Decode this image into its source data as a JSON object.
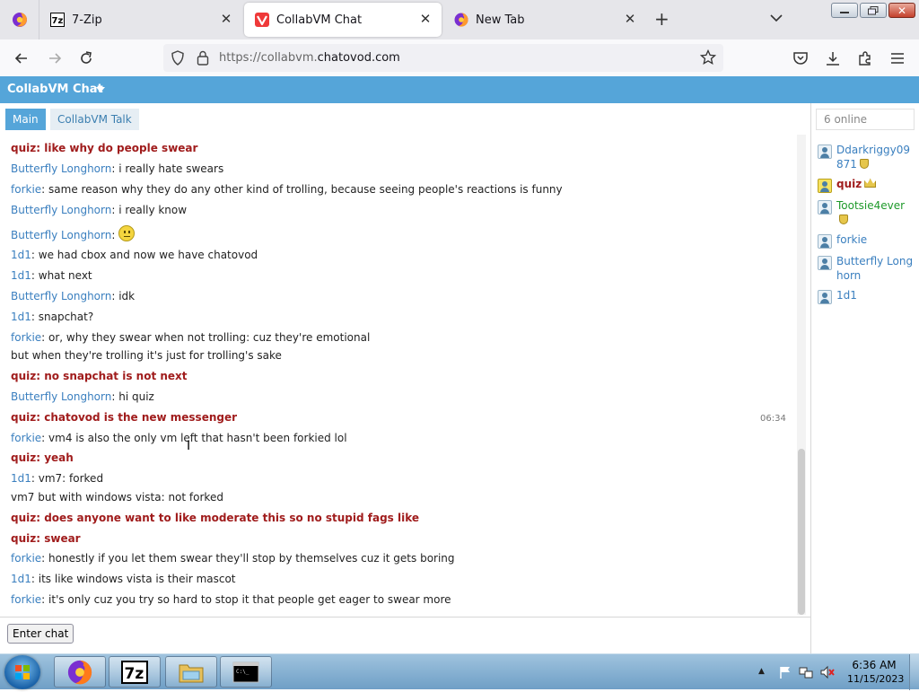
{
  "browser": {
    "tabs": [
      {
        "label": "7-Zip",
        "icon": "7zip-favicon"
      },
      {
        "label": "CollabVM Chat",
        "icon": "vivaldi-favicon",
        "active": true
      },
      {
        "label": "New Tab",
        "icon": "firefox-favicon"
      }
    ],
    "url": {
      "prefix": "https://collabvm.",
      "host": "chatovod.com"
    }
  },
  "app": {
    "title": "CollabVM Chat",
    "channel_tabs": [
      "Main",
      "CollabVM Talk"
    ],
    "enter_chat_label": "Enter chat",
    "timestamp": "06:34"
  },
  "messages": [
    {
      "user": "quiz",
      "text": "like why do people swear",
      "highlight": true
    },
    {
      "user": "Butterfly Longhorn",
      "text": "i really hate swears"
    },
    {
      "user": "forkie",
      "text": "same reason why they do any other kind of trolling, because seeing people's reactions is funny"
    },
    {
      "user": "Butterfly Longhorn",
      "text": "i really know"
    },
    {
      "user": "Butterfly Longhorn",
      "text": "",
      "emoji": "neutral-smiley"
    },
    {
      "user": "1d1",
      "text": "we had cbox and now we have chatovod"
    },
    {
      "user": "1d1",
      "text": "what next"
    },
    {
      "user": "Butterfly Longhorn",
      "text": "idk"
    },
    {
      "user": "1d1",
      "text": "snapchat?"
    },
    {
      "user": "forkie",
      "text": "or, why they swear when not trolling: cuz they're emotional"
    },
    {
      "user": "",
      "text": "but when they're trolling it's just for trolling's sake"
    },
    {
      "user": "quiz",
      "text": "no snapchat is not next",
      "highlight": true
    },
    {
      "user": "Butterfly Longhorn",
      "text": "hi quiz"
    },
    {
      "user": "quiz",
      "text": "chatovod is the new messenger",
      "highlight": true
    },
    {
      "user": "forkie",
      "text": "vm4 is also the only vm left that hasn't been forkied lol"
    },
    {
      "user": "quiz",
      "text": "yeah",
      "highlight": true
    },
    {
      "user": "1d1",
      "text": "vm7: forked"
    },
    {
      "user": "",
      "text": "vm7 but with windows vista: not forked"
    },
    {
      "user": "quiz",
      "text": "does anyone want to like moderate this so no stupid fags like",
      "highlight": true
    },
    {
      "user": "quiz",
      "text": "swear",
      "highlight": true
    },
    {
      "user": "forkie",
      "text": "honestly if you let them swear they'll stop by themselves cuz it gets boring"
    },
    {
      "user": "1d1",
      "text": "its like windows vista is their mascot"
    },
    {
      "user": "forkie",
      "text": "it's only cuz you try so hard to stop it that people get eager to swear more"
    }
  ],
  "userlist": {
    "online_label": "6 online",
    "users": [
      {
        "name": "Ddarkriggy09871",
        "badge": "shield-icon"
      },
      {
        "name": "quiz",
        "badge": "crown-icon",
        "style": "owner"
      },
      {
        "name": "Tootsie4ever",
        "badge": "shield-icon",
        "style": "green"
      },
      {
        "name": "forkie"
      },
      {
        "name": "Butterfly Longhorn"
      },
      {
        "name": "1d1"
      }
    ]
  },
  "taskbar": {
    "time": "6:36 AM",
    "date": "11/15/2023"
  }
}
